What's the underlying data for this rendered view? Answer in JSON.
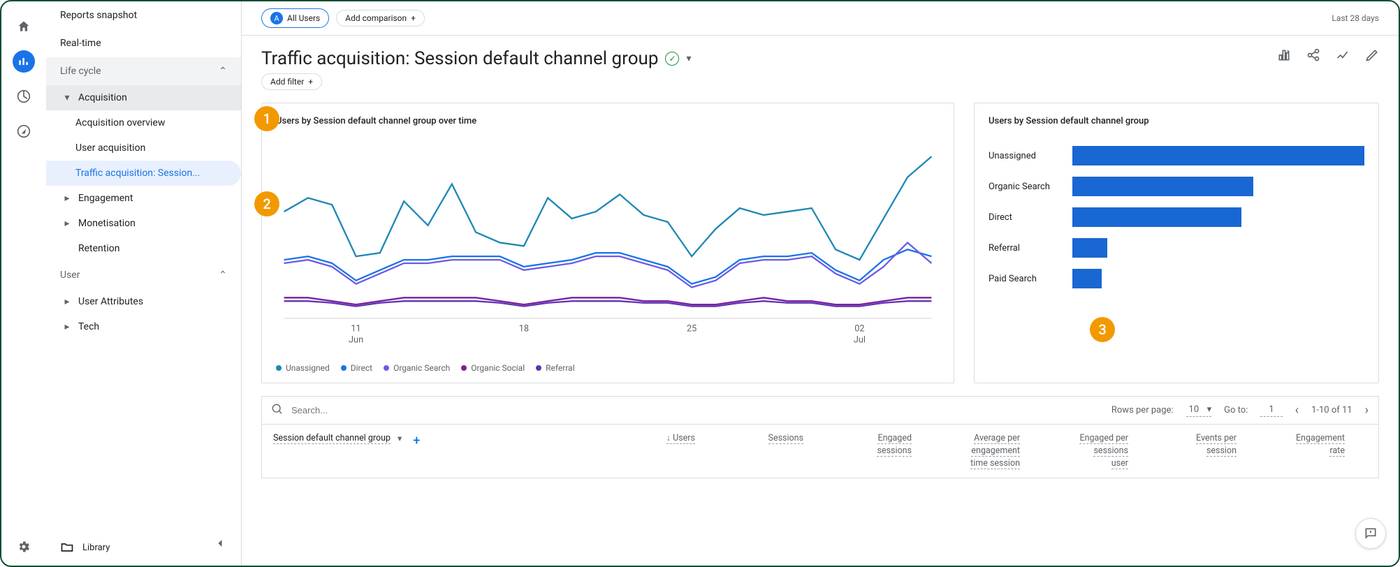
{
  "rail": {
    "items": [
      "home",
      "reports",
      "explore",
      "advertising"
    ]
  },
  "sidebar": {
    "top": [
      "Reports snapshot",
      "Real-time"
    ],
    "sections": [
      {
        "name": "Life cycle",
        "items": [
          {
            "label": "Acquisition",
            "expanded": true,
            "children": [
              "Acquisition overview",
              "User acquisition",
              "Traffic acquisition: Session..."
            ]
          },
          {
            "label": "Engagement"
          },
          {
            "label": "Monetisation"
          },
          {
            "label": "Retention",
            "leaf": true
          }
        ]
      },
      {
        "name": "User",
        "items": [
          {
            "label": "User Attributes"
          },
          {
            "label": "Tech"
          }
        ]
      }
    ],
    "library": "Library"
  },
  "badges": {
    "one": "1",
    "two": "2",
    "three": "3"
  },
  "topbar": {
    "all_users": "All Users",
    "all_users_badge": "A",
    "add_comparison": "Add comparison",
    "date": "Last 28 days"
  },
  "header": {
    "title": "Traffic acquisition: Session default channel group",
    "add_filter": "Add filter"
  },
  "chart_data": [
    {
      "type": "line",
      "title": "Users by Session default channel group over time",
      "x_ticks": [
        {
          "label": "11",
          "sub": "Jun"
        },
        {
          "label": "18",
          "sub": ""
        },
        {
          "label": "25",
          "sub": ""
        },
        {
          "label": "02",
          "sub": "Jul"
        }
      ],
      "series": [
        {
          "name": "Unassigned",
          "color": "#1e88b5",
          "values": [
            62,
            70,
            66,
            36,
            38,
            68,
            54,
            78,
            50,
            44,
            42,
            70,
            58,
            62,
            72,
            60,
            56,
            36,
            52,
            64,
            60,
            62,
            64,
            40,
            34,
            58,
            82,
            94
          ]
        },
        {
          "name": "Direct",
          "color": "#1a73e8",
          "values": [
            34,
            36,
            32,
            22,
            28,
            34,
            34,
            36,
            36,
            36,
            30,
            32,
            34,
            38,
            38,
            34,
            30,
            20,
            24,
            34,
            36,
            36,
            38,
            28,
            22,
            34,
            40,
            36
          ]
        },
        {
          "name": "Organic Search",
          "color": "#6b5ce7",
          "values": [
            32,
            34,
            30,
            20,
            26,
            32,
            32,
            34,
            34,
            34,
            28,
            30,
            32,
            36,
            36,
            32,
            28,
            18,
            22,
            32,
            34,
            34,
            36,
            26,
            20,
            30,
            44,
            32
          ]
        },
        {
          "name": "Organic Social",
          "color": "#7b1fa2",
          "values": [
            12,
            12,
            10,
            8,
            10,
            12,
            12,
            12,
            12,
            10,
            8,
            10,
            12,
            12,
            12,
            10,
            10,
            8,
            8,
            10,
            12,
            10,
            10,
            8,
            8,
            10,
            12,
            12
          ]
        },
        {
          "name": "Referral",
          "color": "#5e35b1",
          "values": [
            10,
            10,
            9,
            7,
            9,
            10,
            10,
            10,
            10,
            9,
            7,
            9,
            10,
            10,
            10,
            9,
            9,
            7,
            7,
            9,
            10,
            9,
            9,
            7,
            7,
            9,
            10,
            10
          ]
        }
      ]
    },
    {
      "type": "bar-horizontal",
      "title": "Users by Session default channel group",
      "categories": [
        "Unassigned",
        "Organic Search",
        "Direct",
        "Referral",
        "Paid Search"
      ],
      "values": [
        100,
        62,
        58,
        12,
        10
      ],
      "color": "#1967d2"
    }
  ],
  "table": {
    "search_placeholder": "Search...",
    "rows_per_page_label": "Rows per page:",
    "rows_per_page_value": "10",
    "goto_label": "Go to:",
    "goto_value": "1",
    "range": "1-10 of 11",
    "dimension": "Session default channel group",
    "columns": [
      "Users",
      "Sessions",
      "Engaged sessions",
      "Average engagement time per session",
      "Engaged sessions per user",
      "Events per session",
      "Engagement rate"
    ]
  }
}
